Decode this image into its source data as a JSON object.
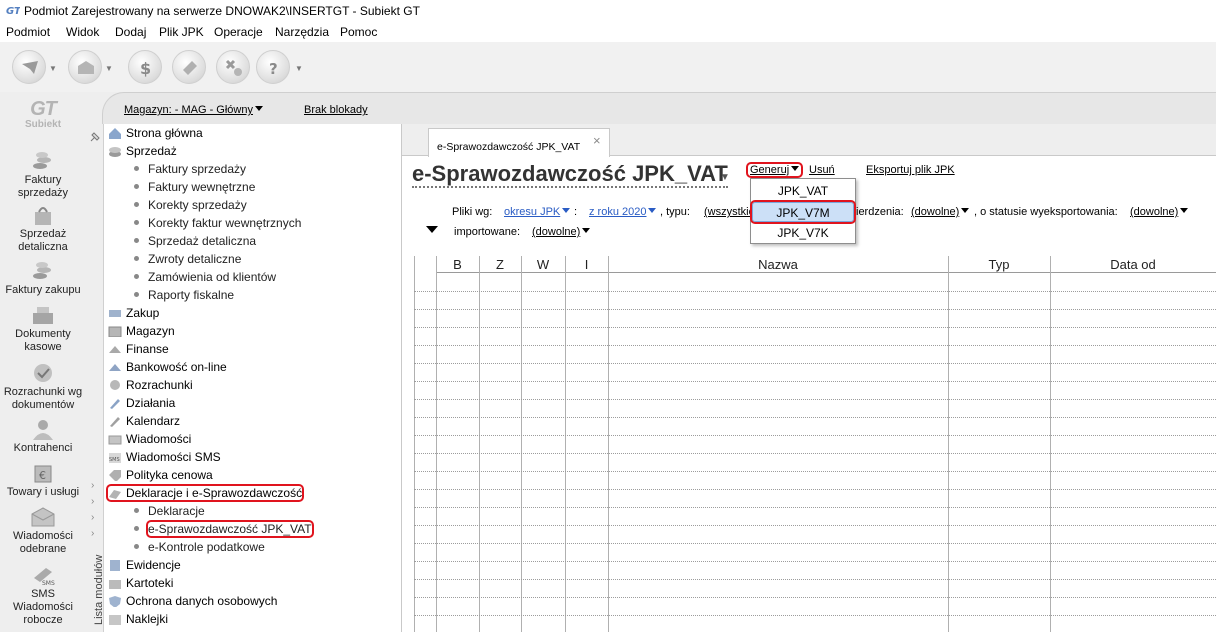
{
  "window": {
    "title": "Podmiot Zarejestrowany na serwerze DNOWAK2\\INSERTGT - Subiekt GT"
  },
  "menu": [
    "Podmiot",
    "Widok",
    "Dodaj",
    "Plik JPK",
    "Operacje",
    "Narzędzia",
    "Pomoc"
  ],
  "brand": {
    "logo_text": "GT",
    "name": "Subiekt"
  },
  "left_nav": [
    {
      "label": "Faktury\nsprzedaży",
      "icon": "coins-icon"
    },
    {
      "label": "Sprzedaż\ndetaliczna",
      "icon": "bag-icon"
    },
    {
      "label": "Faktury zakupu",
      "icon": "coins-icon"
    },
    {
      "label": "Dokumenty\nkasowe",
      "icon": "cash-register-icon"
    },
    {
      "label": "Rozrachunki wg\ndokumentów",
      "icon": "settlements-icon"
    },
    {
      "label": "Kontrahenci",
      "icon": "person-icon"
    },
    {
      "label": "Towary i usługi",
      "icon": "box-icon"
    },
    {
      "label": "Wiadomości\nodebrane",
      "icon": "envelope-icon"
    },
    {
      "label": "SMS\nWiadomości\nrobocze",
      "icon": "sms-icon"
    }
  ],
  "header": {
    "magazyn": "Magazyn: - MAG - Główny",
    "blokady": "Brak blokady"
  },
  "module_strip_label": "Lista modułów",
  "tree": [
    {
      "label": "Strona główna",
      "level": 0
    },
    {
      "label": "Sprzedaż",
      "level": 0
    },
    {
      "label": "Faktury sprzedaży",
      "level": 1
    },
    {
      "label": "Faktury wewnętrzne",
      "level": 1
    },
    {
      "label": "Korekty sprzedaży",
      "level": 1
    },
    {
      "label": "Korekty faktur wewnętrznych",
      "level": 1
    },
    {
      "label": "Sprzedaż detaliczna",
      "level": 1
    },
    {
      "label": "Zwroty detaliczne",
      "level": 1
    },
    {
      "label": "Zamówienia od klientów",
      "level": 1
    },
    {
      "label": "Raporty fiskalne",
      "level": 1
    },
    {
      "label": "Zakup",
      "level": 0
    },
    {
      "label": "Magazyn",
      "level": 0
    },
    {
      "label": "Finanse",
      "level": 0
    },
    {
      "label": "Bankowość on-line",
      "level": 0
    },
    {
      "label": "Rozrachunki",
      "level": 0
    },
    {
      "label": "Działania",
      "level": 0
    },
    {
      "label": "Kalendarz",
      "level": 0
    },
    {
      "label": "Wiadomości",
      "level": 0
    },
    {
      "label": "Wiadomości SMS",
      "level": 0
    },
    {
      "label": "Polityka cenowa",
      "level": 0
    },
    {
      "label": "Deklaracje i e-Sprawozdawczość",
      "level": 0
    },
    {
      "label": "Deklaracje",
      "level": 1
    },
    {
      "label": "e-Sprawozdawczość JPK_VAT",
      "level": 1
    },
    {
      "label": "e-Kontrole podatkowe",
      "level": 1
    },
    {
      "label": "Ewidencje",
      "level": 0
    },
    {
      "label": "Kartoteki",
      "level": 0
    },
    {
      "label": "Ochrona danych osobowych",
      "level": 0
    },
    {
      "label": "Naklejki",
      "level": 0
    }
  ],
  "tab": {
    "label": "e-Sprawozdawczość JPK_VAT",
    "close": "×"
  },
  "page": {
    "title": "e-Sprawozdawczość JPK_VAT",
    "generuj": "Generuj",
    "usun": "Usuń",
    "eksportuj": "Eksportuj plik JPK"
  },
  "generuj_menu": [
    "JPK_VAT",
    "JPK_V7M",
    "JPK_V7K"
  ],
  "filters": {
    "pliki_wg": "Pliki wg:",
    "okres": "okresu JPK",
    "colon": ":",
    "rok": "z roku 2020",
    "typu": ", typu:",
    "wszystkie": "(wszystkie",
    "zatwierdzenia": "ierdzenia:",
    "dowolne1": "(dowolne)",
    "status_label": ", o statusie wyeksportowania:",
    "dowolne2": "(dowolne)",
    "importowane_label": "importowane:",
    "dowolne3": "(dowolne)"
  },
  "grid": {
    "columns": [
      "B",
      "Z",
      "W",
      "I",
      "Nazwa",
      "Typ",
      "Data od"
    ]
  }
}
